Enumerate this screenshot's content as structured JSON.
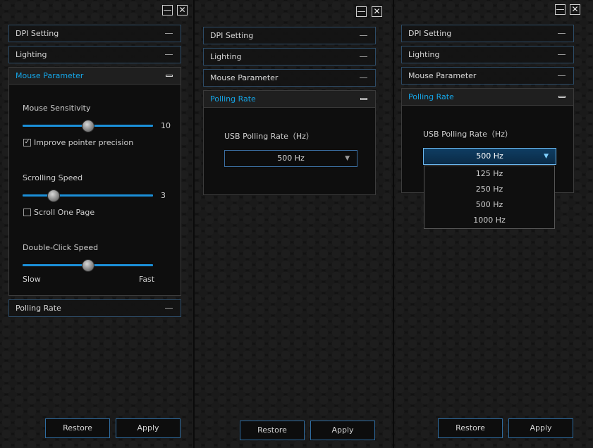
{
  "window_controls": {
    "minimize": "—",
    "close": "✕"
  },
  "sections": {
    "dpi": "DPI Setting",
    "lighting": "Lighting",
    "mouse_parameter": "Mouse Parameter",
    "polling_rate": "Polling Rate"
  },
  "mouse_parameter": {
    "sensitivity_label": "Mouse Sensitivity",
    "sensitivity_value": "10",
    "sensitivity_fraction": 0.5,
    "precision_label": "Improve pointer precision",
    "precision_checked": true,
    "scroll_label": "Scrolling Speed",
    "scroll_value": "3",
    "scroll_fraction": 0.24,
    "scroll_page_label": "Scroll One Page",
    "scroll_page_checked": false,
    "doubleclick_label": "Double-Click Speed",
    "doubleclick_fraction": 0.5,
    "slow_label": "Slow",
    "fast_label": "Fast"
  },
  "polling": {
    "usb_label": "USB Polling Rate（Hz）",
    "selected": "500 Hz",
    "options": [
      "125 Hz",
      "250 Hz",
      "500 Hz",
      "1000 Hz"
    ]
  },
  "buttons": {
    "restore": "Restore",
    "apply": "Apply"
  },
  "colors": {
    "accent": "#15a5e6",
    "border": "#2d4b66"
  }
}
